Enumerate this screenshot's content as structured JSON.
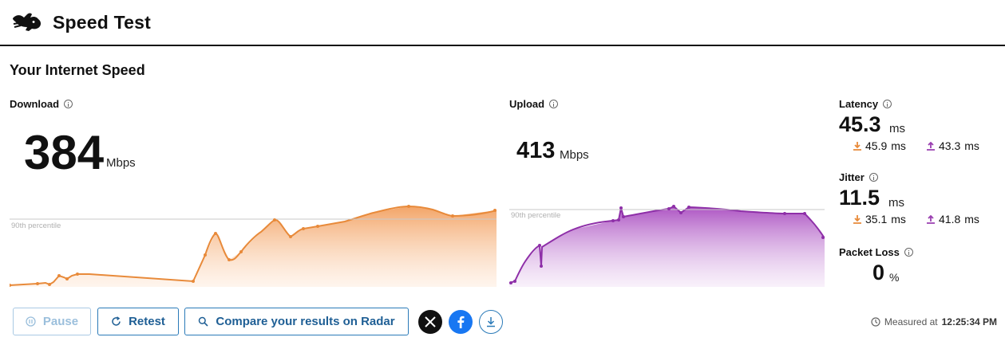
{
  "header": {
    "title": "Speed Test",
    "logo_icon": "rabbit-icon"
  },
  "section_title": "Your Internet Speed",
  "download": {
    "label": "Download",
    "value": "384",
    "unit": "Mbps",
    "percentile_label": "90th percentile",
    "color": "#e88a3a"
  },
  "upload": {
    "label": "Upload",
    "value": "413",
    "unit": "Mbps",
    "percentile_label": "90th percentile",
    "color": "#9a3fb0"
  },
  "latency": {
    "label": "Latency",
    "value": "45.3",
    "unit": "ms",
    "download_value": "45.9",
    "upload_value": "43.3",
    "sub_unit": "ms"
  },
  "jitter": {
    "label": "Jitter",
    "value": "11.5",
    "unit": "ms",
    "download_value": "35.1",
    "upload_value": "41.8",
    "sub_unit": "ms"
  },
  "packet_loss": {
    "label": "Packet Loss",
    "value": "0",
    "unit": "%"
  },
  "buttons": {
    "pause": "Pause",
    "retest": "Retest",
    "compare": "Compare your results on Radar"
  },
  "share": {
    "x_icon": "x-logo-icon",
    "facebook_icon": "facebook-icon",
    "download_icon": "download-icon"
  },
  "measured": {
    "label": "Measured at",
    "time": "12:25:34 PM"
  },
  "colors": {
    "accent": "#2a7ab8",
    "download": "#e88a3a",
    "upload": "#9a3fb0"
  }
}
